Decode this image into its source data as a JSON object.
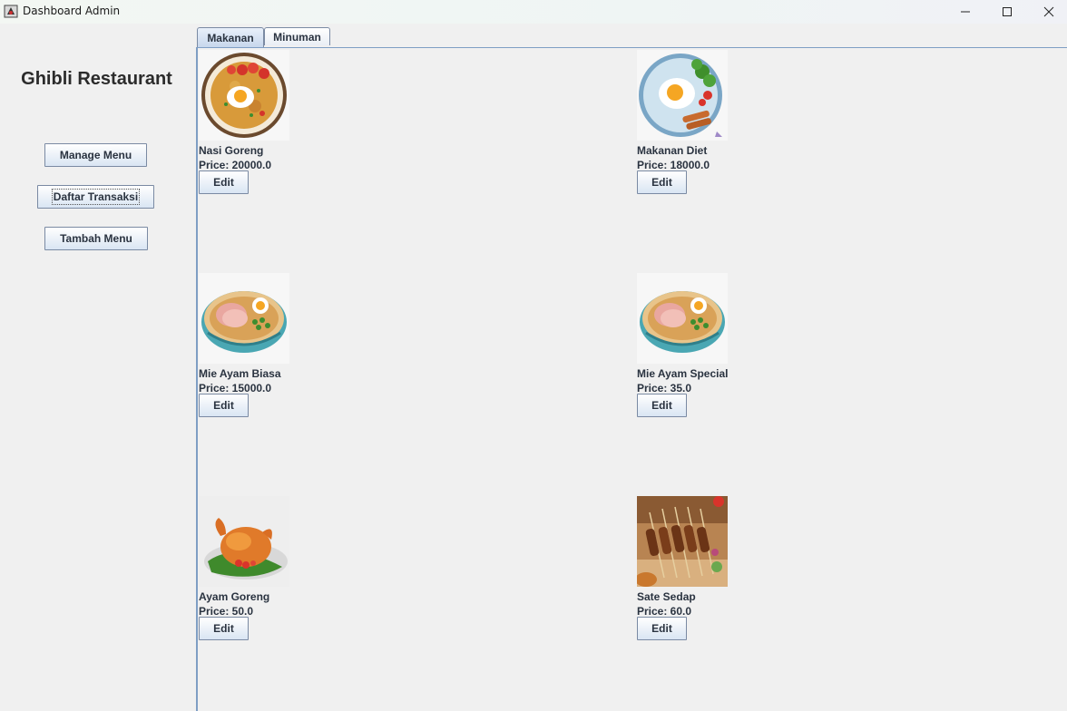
{
  "window": {
    "title": "Dashboard Admin"
  },
  "sidebar": {
    "restaurant_name": "Ghibli Restaurant",
    "buttons": [
      "Manage Menu",
      "Daftar Transaksi",
      "Tambah Menu"
    ]
  },
  "tabs": [
    {
      "label": "Makanan",
      "active": true
    },
    {
      "label": "Minuman",
      "active": false
    }
  ],
  "menu": {
    "price_prefix": "Price: ",
    "edit_label": "Edit",
    "items": [
      {
        "name": "Nasi Goreng",
        "price": "Price: 20000.0",
        "image": "fried-rice-image"
      },
      {
        "name": "Makanan Diet",
        "price": "Price: 18000.0",
        "image": "diet-plate-image"
      },
      {
        "name": "Mie Ayam Biasa",
        "price": "Price: 15000.0",
        "image": "noodle-bowl-image"
      },
      {
        "name": "Mie Ayam Special",
        "price": "Price: 35.0",
        "image": "noodle-bowl-image"
      },
      {
        "name": "Ayam Goreng",
        "price": "Price: 50.0",
        "image": "fried-chicken-image"
      },
      {
        "name": "Sate Sedap",
        "price": "Price: 60.0",
        "image": "satay-image"
      }
    ]
  },
  "colors": {
    "background": "#f0f0f0",
    "panel_border": "#7f9ec4",
    "button_border": "#7a8aa3",
    "text": "#2a3340"
  }
}
